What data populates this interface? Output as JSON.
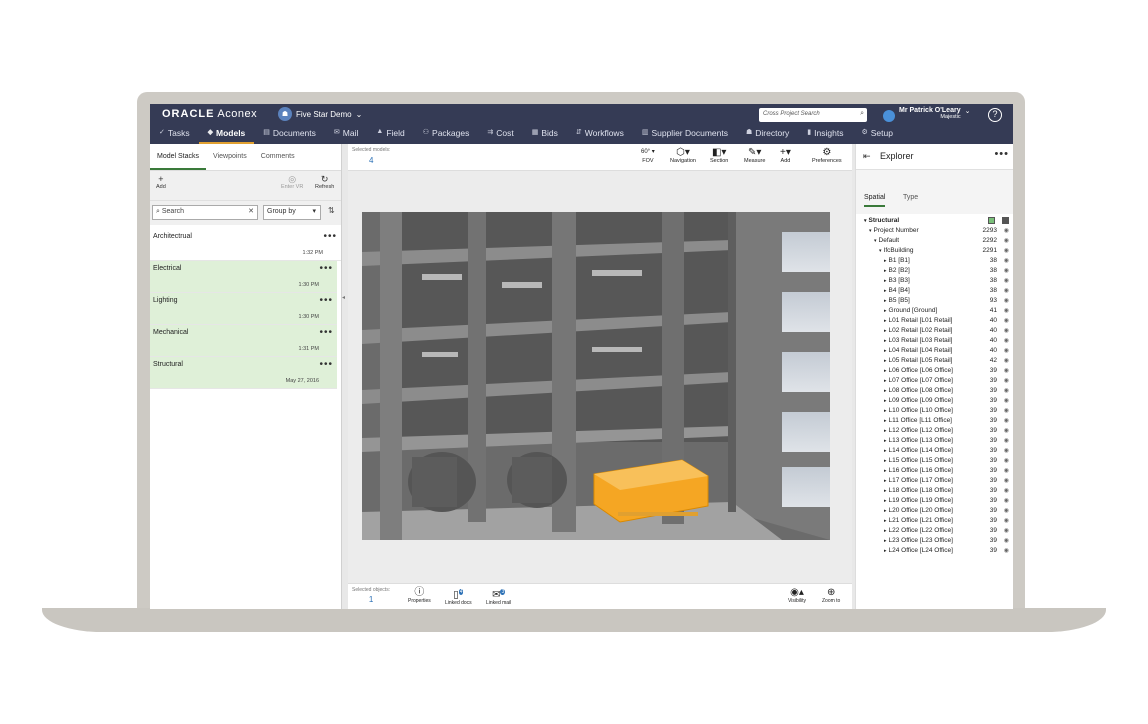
{
  "header": {
    "brand_oracle": "ORACLE",
    "brand_product": "Aconex",
    "project_name": "Five Star Demo",
    "cross_search_placeholder": "Cross Project Search",
    "user_name": "Mr Patrick O'Leary",
    "user_org": "Majestic",
    "help_glyph": "?"
  },
  "nav": [
    {
      "label": "Tasks",
      "icon": "check-icon",
      "glyph": "✓"
    },
    {
      "label": "Models",
      "icon": "cube-icon",
      "glyph": "◆",
      "active": true
    },
    {
      "label": "Documents",
      "icon": "document-icon",
      "glyph": "▤"
    },
    {
      "label": "Mail",
      "icon": "mail-icon",
      "glyph": "✉"
    },
    {
      "label": "Field",
      "icon": "field-icon",
      "glyph": "▲"
    },
    {
      "label": "Packages",
      "icon": "packages-icon",
      "glyph": "⚇"
    },
    {
      "label": "Cost",
      "icon": "cost-icon",
      "glyph": "⇉"
    },
    {
      "label": "Bids",
      "icon": "bids-icon",
      "glyph": "▦"
    },
    {
      "label": "Workflows",
      "icon": "workflow-icon",
      "glyph": "⇵"
    },
    {
      "label": "Supplier Documents",
      "icon": "supplier-icon",
      "glyph": "▥"
    },
    {
      "label": "Directory",
      "icon": "directory-icon",
      "glyph": "☗"
    },
    {
      "label": "Insights",
      "icon": "insights-icon",
      "glyph": "▮"
    },
    {
      "label": "Setup",
      "icon": "gear-icon",
      "glyph": "⚙"
    }
  ],
  "left_panel": {
    "tabs": [
      "Model Stacks",
      "Viewpoints",
      "Comments"
    ],
    "add_label": "Add",
    "enter_vr_label": "Enter VR",
    "refresh_label": "Refresh",
    "search_placeholder": "Search",
    "group_by_label": "Group by",
    "stacks": [
      {
        "name": "Architectrual",
        "date": "1:32 PM",
        "selected": false
      },
      {
        "name": "Electrical",
        "date": "1:30 PM",
        "selected": true
      },
      {
        "name": "Lighting",
        "date": "1:30 PM",
        "selected": true
      },
      {
        "name": "Mechanical",
        "date": "1:31 PM",
        "selected": true
      },
      {
        "name": "Structural",
        "date": "May 27, 2016",
        "selected": true
      }
    ]
  },
  "viewer": {
    "selected_models_label": "Selected models:",
    "selected_models_count": "4",
    "fov_value": "60°",
    "fov_label": "FOV",
    "navigation_label": "Navigation",
    "section_label": "Section",
    "measure_label": "Measure",
    "add_label": "Add",
    "preferences_label": "Preferences",
    "selected_objects_label": "Selected objects:",
    "selected_objects_count": "1",
    "properties_label": "Properties",
    "linked_docs_label": "Linked docs",
    "linked_docs_badge": "4",
    "linked_mail_label": "Linked mail",
    "linked_mail_badge": "3",
    "visibility_label": "Visibility",
    "zoom_label": "Zoom to"
  },
  "explorer": {
    "title": "Explorer",
    "tabs": [
      "Spatial",
      "Type"
    ],
    "tree": [
      {
        "label": "Structural",
        "count": "",
        "level": 0,
        "expanded": true,
        "root": true
      },
      {
        "label": "Project Number",
        "count": "2293",
        "level": 1,
        "expanded": true
      },
      {
        "label": "Default",
        "count": "2292",
        "level": 2,
        "expanded": true
      },
      {
        "label": "IfcBuilding",
        "count": "2291",
        "level": 3,
        "expanded": true
      },
      {
        "label": "B1 [B1]",
        "count": "38",
        "level": 4
      },
      {
        "label": "B2 [B2]",
        "count": "38",
        "level": 4
      },
      {
        "label": "B3 [B3]",
        "count": "38",
        "level": 4
      },
      {
        "label": "B4 [B4]",
        "count": "38",
        "level": 4
      },
      {
        "label": "B5 [B5]",
        "count": "93",
        "level": 4
      },
      {
        "label": "Ground [Ground]",
        "count": "41",
        "level": 4
      },
      {
        "label": "L01 Retail [L01 Retail]",
        "count": "40",
        "level": 4
      },
      {
        "label": "L02 Retail [L02 Retail]",
        "count": "40",
        "level": 4
      },
      {
        "label": "L03 Retail [L03 Retail]",
        "count": "40",
        "level": 4
      },
      {
        "label": "L04 Retail [L04 Retail]",
        "count": "40",
        "level": 4
      },
      {
        "label": "L05 Retail [L05 Retail]",
        "count": "42",
        "level": 4
      },
      {
        "label": "L06 Office [L06 Office]",
        "count": "39",
        "level": 4
      },
      {
        "label": "L07 Office [L07 Office]",
        "count": "39",
        "level": 4
      },
      {
        "label": "L08 Office [L08 Office]",
        "count": "39",
        "level": 4
      },
      {
        "label": "L09 Office [L09 Office]",
        "count": "39",
        "level": 4
      },
      {
        "label": "L10 Office [L10 Office]",
        "count": "39",
        "level": 4
      },
      {
        "label": "L11 Office [L11 Office]",
        "count": "39",
        "level": 4
      },
      {
        "label": "L12 Office [L12 Office]",
        "count": "39",
        "level": 4
      },
      {
        "label": "L13 Office [L13 Office]",
        "count": "39",
        "level": 4
      },
      {
        "label": "L14 Office [L14 Office]",
        "count": "39",
        "level": 4
      },
      {
        "label": "L15 Office [L15 Office]",
        "count": "39",
        "level": 4
      },
      {
        "label": "L16 Office [L16 Office]",
        "count": "39",
        "level": 4
      },
      {
        "label": "L17 Office [L17 Office]",
        "count": "39",
        "level": 4
      },
      {
        "label": "L18 Office [L18 Office]",
        "count": "39",
        "level": 4
      },
      {
        "label": "L19 Office [L19 Office]",
        "count": "39",
        "level": 4
      },
      {
        "label": "L20 Office [L20 Office]",
        "count": "39",
        "level": 4
      },
      {
        "label": "L21 Office [L21 Office]",
        "count": "39",
        "level": 4
      },
      {
        "label": "L22 Office [L22 Office]",
        "count": "39",
        "level": 4
      },
      {
        "label": "L23 Office [L23 Office]",
        "count": "39",
        "level": 4
      },
      {
        "label": "L24 Office [L24 Office]",
        "count": "39",
        "level": 4
      }
    ]
  },
  "colors": {
    "header_bg": "#353b55",
    "active_tab_underline": "#e0a030",
    "selected_stack_bg": "#dff0d8",
    "count_blue": "#2a6fb5",
    "highlight_orange": "#f5a623"
  }
}
